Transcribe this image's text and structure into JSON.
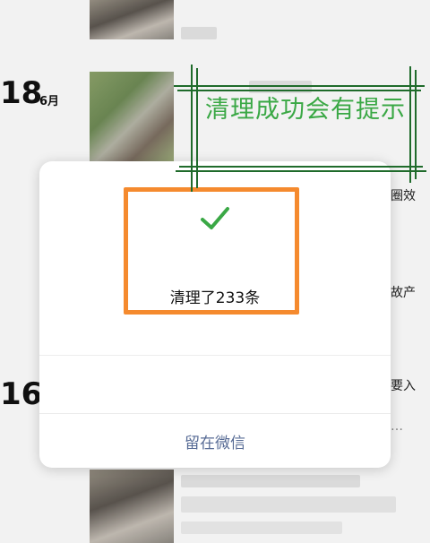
{
  "feed": {
    "date1_day": "18",
    "date1_month": "6月",
    "date2_day": "16",
    "snippets": [
      "圈效",
      "故产",
      "要入",
      "…"
    ]
  },
  "dialog": {
    "result_text": "清理了233条",
    "stay_button": "留在微信",
    "check_icon": "check-icon",
    "accent_color": "#3aa845",
    "link_color": "#576b95"
  },
  "annotation": {
    "text": "清理成功会有提示",
    "color": "#3aa845",
    "highlight_color": "#f58a2e"
  }
}
